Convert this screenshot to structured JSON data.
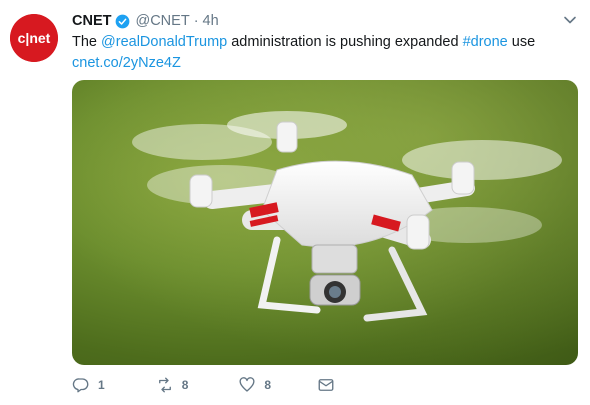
{
  "tweet": {
    "author_name": "CNET",
    "handle": "@CNET",
    "separator": "·",
    "time": "4h",
    "text_prefix": "The ",
    "mention": "@realDonaldTrump",
    "text_middle": " administration is pushing expanded ",
    "hashtag": "#drone",
    "text_suffix": " use",
    "link": "cnet.co/2yNze4Z"
  },
  "actions": {
    "reply_count": "1",
    "retweet_count": "8",
    "like_count": "8"
  },
  "colors": {
    "brand": "#d71920",
    "link": "#1b95e0",
    "muted": "#657786"
  },
  "icons": [
    "verified-icon",
    "chevron-down-icon",
    "reply-icon",
    "retweet-icon",
    "like-icon",
    "message-icon"
  ]
}
